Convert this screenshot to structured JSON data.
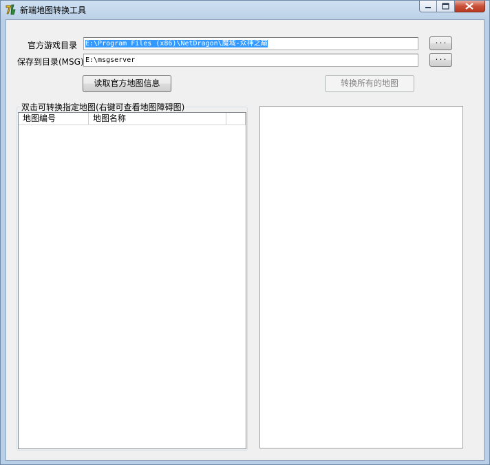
{
  "window": {
    "title": "新端地图转换工具",
    "icon": "app-logo-icon"
  },
  "caption": {
    "min_icon": "minimize-icon",
    "max_icon": "maximize-icon",
    "close_icon": "close-icon"
  },
  "form": {
    "game_dir_label": "官方游戏目录",
    "game_dir_value": "E:\\Program Files (x86)\\NetDragon\\魔域-众神之巅",
    "save_dir_label": "保存到目录(MSG)",
    "save_dir_value": "E:\\msgserver",
    "browse_label": "..."
  },
  "buttons": {
    "read_info": "读取官方地图信息",
    "convert_all": "转换所有的地图"
  },
  "map_group": {
    "title": "双击可转换指定地图(右键可查看地图障碍图)",
    "columns": [
      "地图编号",
      "地图名称",
      ""
    ],
    "rows": []
  },
  "log": {
    "text": ""
  },
  "colors": {
    "selection": "#3399ff",
    "client_bg": "#f0f0f0",
    "title_gradient": "#b9cfe7"
  }
}
